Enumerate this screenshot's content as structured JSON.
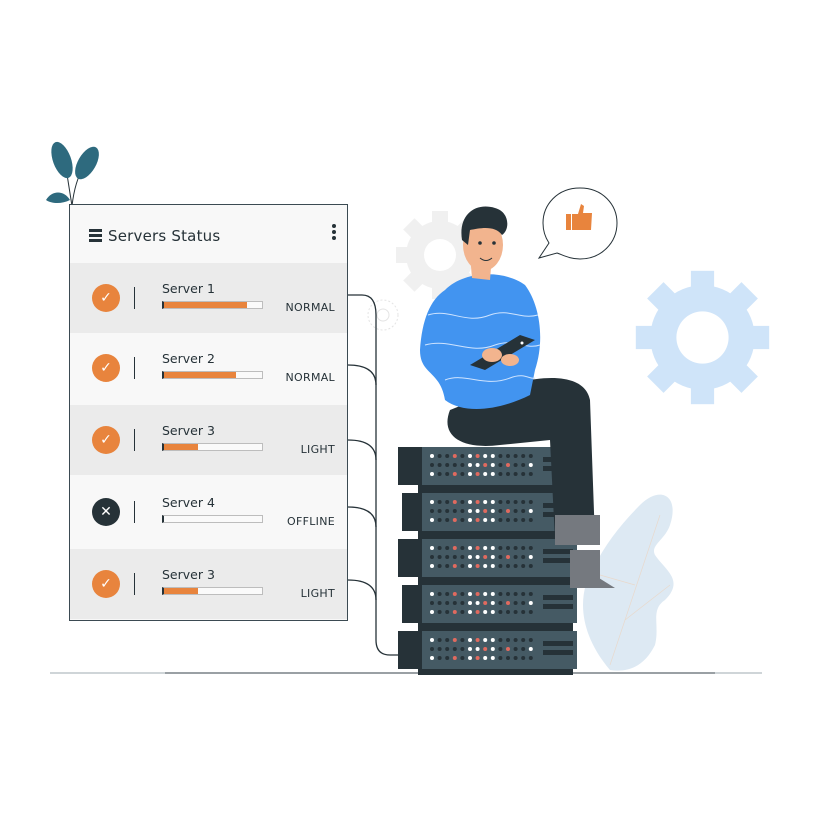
{
  "panel": {
    "title": "Servers Status",
    "header_icon": "menu-icon",
    "more_icon": "kebab-icon",
    "servers": [
      {
        "name": "Server 1",
        "status": "NORMAL",
        "load": 0.85,
        "state": "ok",
        "icon": "check-icon",
        "icon_glyph": "✓"
      },
      {
        "name": "Server 2",
        "status": "NORMAL",
        "load": 0.73,
        "state": "ok",
        "icon": "check-icon",
        "icon_glyph": "✓"
      },
      {
        "name": "Server 3",
        "status": "LIGHT",
        "load": 0.35,
        "state": "ok",
        "icon": "check-icon",
        "icon_glyph": "✓"
      },
      {
        "name": "Server 4",
        "status": "OFFLINE",
        "load": 0.0,
        "state": "offline",
        "icon": "close-icon",
        "icon_glyph": "✕"
      },
      {
        "name": "Server 3",
        "status": "LIGHT",
        "load": 0.35,
        "state": "ok",
        "icon": "check-icon",
        "icon_glyph": "✓"
      }
    ]
  },
  "illustration": {
    "speech_bubble_icon": "thumbs-up-icon",
    "rack_units": 5
  },
  "colors": {
    "accent_orange": "#e8843d",
    "dark": "#263238",
    "rack": "#455a64",
    "shirt_blue": "#4294f0",
    "gear_light_blue": "#cfe4f9",
    "leaf_teal": "#2e6a7e",
    "led_red": "#e06a5f"
  }
}
